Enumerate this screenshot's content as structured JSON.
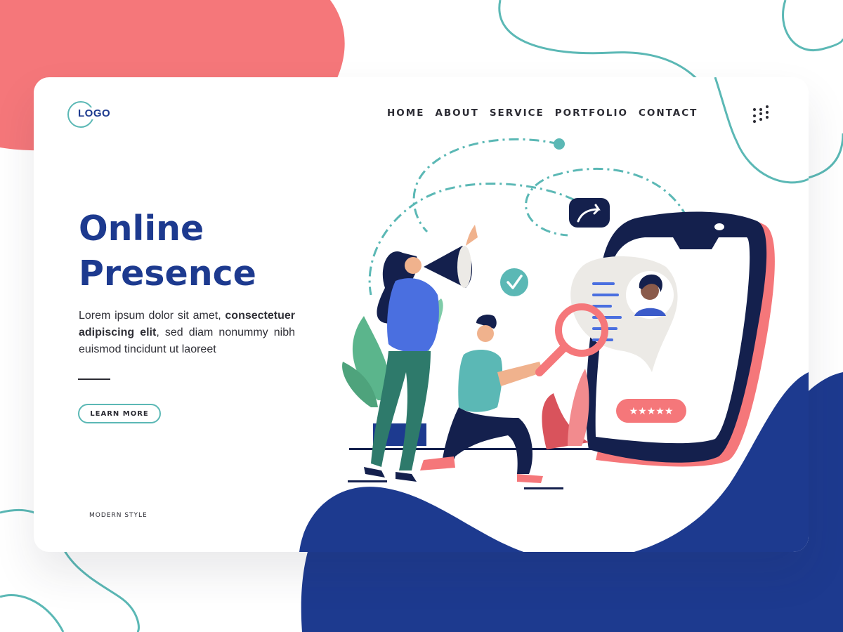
{
  "logo": {
    "text": "LOGO"
  },
  "nav": {
    "items": [
      "HOME",
      "ABOUT",
      "SERVICE",
      "PORTFOLIO",
      "CONTACT"
    ]
  },
  "hero": {
    "title_line1": "Online",
    "title_line2": "Presence",
    "desc_part1": "Lorem ipsum dolor sit amet, ",
    "desc_bold": "consectetuer adipiscing elit",
    "desc_part2": ", sed diam nonummy nibh euismod tincidunt ut laoreet",
    "cta_label": "LEARN MORE"
  },
  "footer": {
    "style_label": "MODERN STYLE"
  },
  "illustration": {
    "rating_stars": "★★★★★"
  },
  "colors": {
    "brand_blue": "#1d3a8f",
    "coral": "#f5777a",
    "teal": "#5bb8b5",
    "navy": "#14204d"
  },
  "icons": [
    "menu-dots-icon",
    "share-arrow-icon",
    "check-icon",
    "magnifier-icon",
    "megaphone-icon"
  ]
}
